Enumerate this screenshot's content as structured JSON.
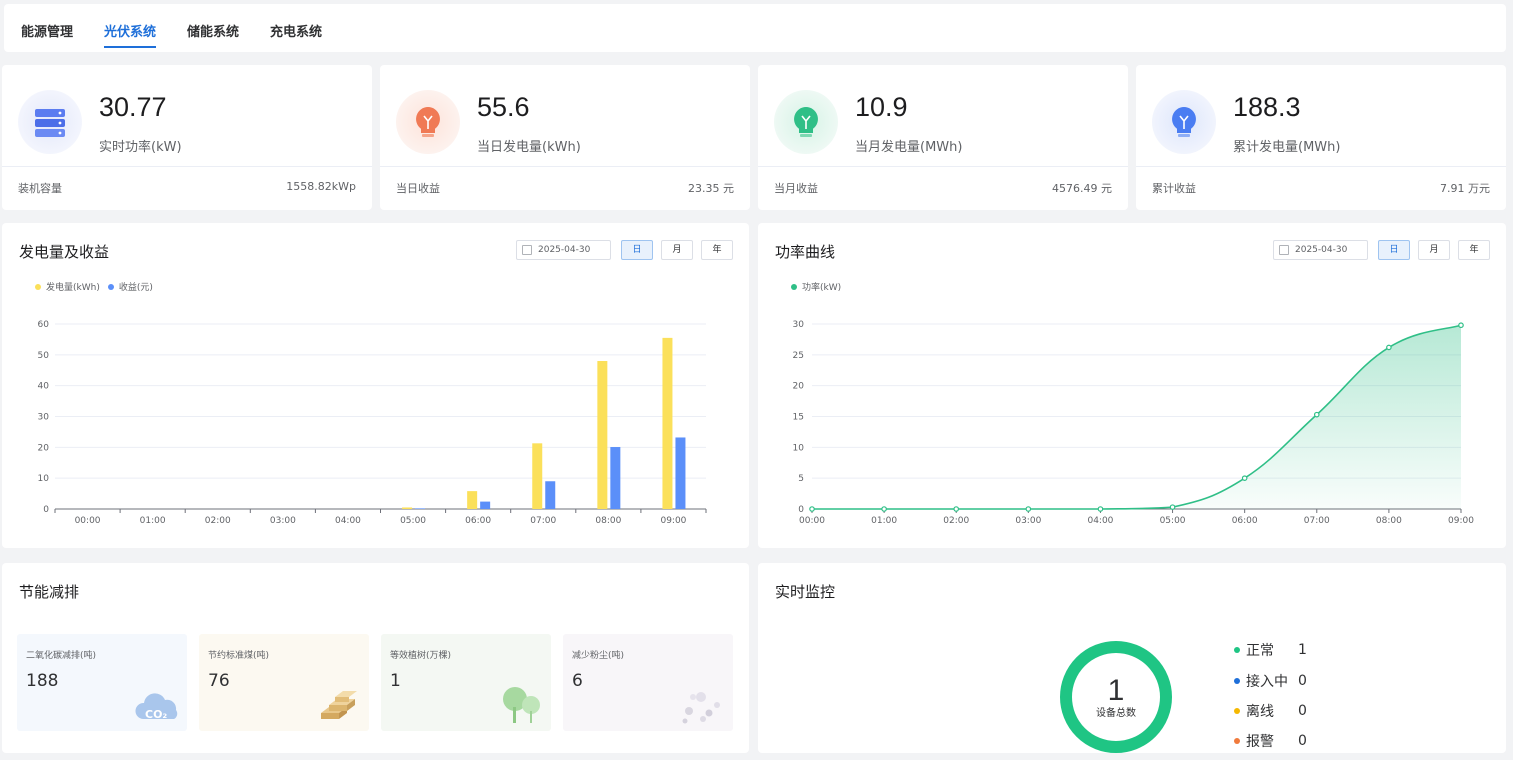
{
  "nav": {
    "tabs": [
      {
        "label": "能源管理",
        "active": false
      },
      {
        "label": "光伏系统",
        "active": true
      },
      {
        "label": "储能系统",
        "active": false
      },
      {
        "label": "充电系统",
        "active": false
      }
    ]
  },
  "stats": [
    {
      "value": "30.77",
      "label": "实时功率(kW)",
      "sub_label": "装机容量",
      "sub_value": "1558.82kWp",
      "icon": "server-stack-icon",
      "color": "#5b7cf0"
    },
    {
      "value": "55.6",
      "label": "当日发电量(kWh)",
      "sub_label": "当日收益",
      "sub_value": "23.35 元",
      "icon": "lightbulb-icon",
      "color": "#f07a55"
    },
    {
      "value": "10.9",
      "label": "当月发电量(MWh)",
      "sub_label": "当月收益",
      "sub_value": "4576.49 元",
      "icon": "lightbulb-icon",
      "color": "#2fbf87"
    },
    {
      "value": "188.3",
      "label": "累计发电量(MWh)",
      "sub_label": "累计收益",
      "sub_value": "7.91 万元",
      "icon": "lightbulb-icon",
      "color": "#4a7df2"
    }
  ],
  "generation_panel": {
    "title": "发电量及收益",
    "date": "2025-04-30",
    "periods": [
      "日",
      "月",
      "年"
    ],
    "active_period": "日"
  },
  "power_panel": {
    "title": "功率曲线",
    "date": "2025-04-30",
    "periods": [
      "日",
      "月",
      "年"
    ],
    "active_period": "日"
  },
  "chart_data": [
    {
      "type": "bar",
      "categories": [
        "00:00",
        "01:00",
        "02:00",
        "03:00",
        "04:00",
        "05:00",
        "06:00",
        "07:00",
        "08:00",
        "09:00"
      ],
      "series": [
        {
          "name": "发电量(kWh)",
          "color": "#fbe05a",
          "values": [
            0,
            0,
            0,
            0,
            0,
            0.5,
            5.8,
            21.3,
            48,
            55.5
          ]
        },
        {
          "name": "收益(元)",
          "color": "#5b8ff9",
          "values": [
            0,
            0,
            0,
            0,
            0,
            0.2,
            2.4,
            9,
            20.1,
            23.2
          ]
        }
      ],
      "yticks": [
        0,
        10,
        20,
        30,
        40,
        50,
        60
      ],
      "ylim": [
        0,
        60
      ],
      "grid": true,
      "legend": "top-left"
    },
    {
      "type": "area",
      "categories": [
        "00:00",
        "01:00",
        "02:00",
        "03:00",
        "04:00",
        "05:00",
        "06:00",
        "07:00",
        "08:00",
        "09:00"
      ],
      "series": [
        {
          "name": "功率(kW)",
          "color": "#2fbf87",
          "values": [
            0,
            0,
            0,
            0,
            0,
            0.3,
            5,
            15.3,
            26.2,
            29.8
          ]
        }
      ],
      "yticks": [
        0,
        5,
        10,
        15,
        20,
        25,
        30
      ],
      "ylim": [
        0,
        30
      ],
      "grid": true,
      "legend": "top-left"
    }
  ],
  "eco_panel": {
    "title": "节能减排",
    "items": [
      {
        "label": "二氧化碳减排(吨)",
        "value": "188",
        "icon": "co2-cloud-icon",
        "bg": "#f4f8fd"
      },
      {
        "label": "节约标准煤(吨)",
        "value": "76",
        "icon": "gold-bars-icon",
        "bg": "#fcf9f1"
      },
      {
        "label": "等效植树(万棵)",
        "value": "1",
        "icon": "tree-icon",
        "bg": "#f4f8f3"
      },
      {
        "label": "减少粉尘(吨)",
        "value": "6",
        "icon": "dust-icon",
        "bg": "#f8f6f9"
      }
    ],
    "co2_text": "CO₂"
  },
  "monitor_panel": {
    "title": "实时监控",
    "total": "1",
    "total_label": "设备总数",
    "statuses": [
      {
        "label": "正常",
        "count": "1",
        "color": "#1fc584"
      },
      {
        "label": "接入中",
        "count": "0",
        "color": "#1e6fd9"
      },
      {
        "label": "离线",
        "count": "0",
        "color": "#f5b800"
      },
      {
        "label": "报警",
        "count": "0",
        "color": "#f07a3c"
      }
    ]
  }
}
